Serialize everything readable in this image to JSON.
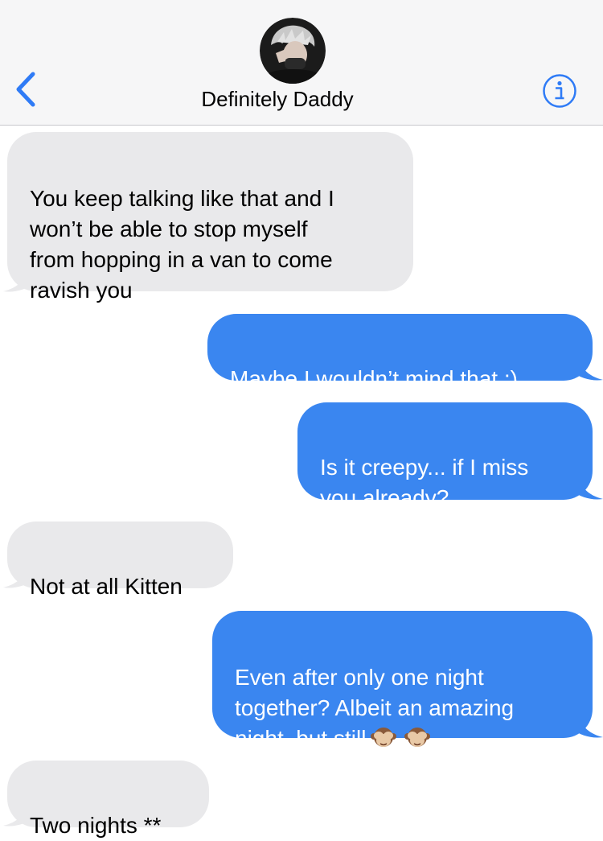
{
  "header": {
    "contact_name": "Definitely Daddy",
    "back_icon": "chevron-left-icon",
    "info_icon": "info-circle-icon",
    "accent_color": "#2f7bf6"
  },
  "messages": [
    {
      "direction": "incoming",
      "text": "You keep talking like that and I\nwon’t be able to stop myself\nfrom hopping in a van to come\nravish you"
    },
    {
      "direction": "outgoing",
      "text": "Maybe I wouldn’t mind that ;)"
    },
    {
      "direction": "outgoing",
      "text": "Is it creepy... if I miss\nyou already?"
    },
    {
      "direction": "incoming",
      "text": "Not at all Kitten"
    },
    {
      "direction": "outgoing",
      "text": "Even after only one night\ntogether? Albeit an amazing\nnight, but still",
      "emoji": [
        "see-no-evil-monkey-icon",
        "see-no-evil-monkey-icon"
      ]
    },
    {
      "direction": "incoming",
      "text": "Two nights **"
    }
  ],
  "colors": {
    "incoming_bubble": "#e9e9eb",
    "outgoing_bubble": "#3a86f0"
  }
}
